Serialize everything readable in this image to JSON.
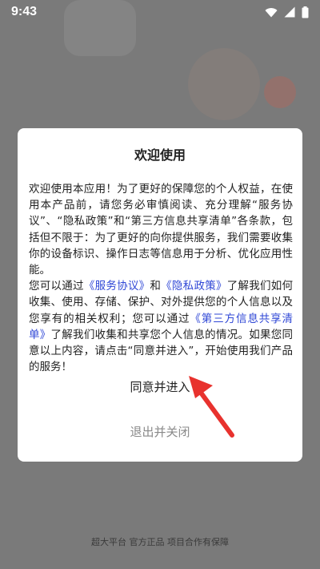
{
  "status_bar": {
    "time": "9:43",
    "icons": [
      "wifi-icon",
      "cellular-signal-icon",
      "battery-icon"
    ]
  },
  "dialog": {
    "title": "欢迎使用",
    "body": {
      "intro": "欢迎使用本应用！为了更好的保障您的个人权益，在使用本产品前，请您务必审慎阅读、充分理解“服务协议”、“隐私政策”和“第三方信息共享清单”各条款，包括但不限于：为了更好的向你提供服务，我们需要收集你的设备标识、操作日志等信息用于分析、优化应用性能。",
      "seg1": "您可以通过",
      "link_service": "《服务协议》",
      "seg2": "和",
      "link_privacy": "《隐私政策》",
      "seg3": "了解我们如何收集、使用、存储、保护、对外提供您的个人信息以及您享有的相关权利；您可以通过",
      "link_third_party": "《第三方信息共享清单》",
      "seg4": "了解我们收集和共享您个人信息的情况。如果您同意以上内容，请点击“同意并进入”，开始使用我们产品的服务！"
    },
    "agree_label": "同意并进入",
    "exit_label": "退出并关闭"
  },
  "footer": {
    "text": "超大平台 官方正品 项目合作有保障"
  },
  "colors": {
    "link": "#2f47d6",
    "overlay": "#7a7a7a",
    "arrow": "#e8322e"
  }
}
